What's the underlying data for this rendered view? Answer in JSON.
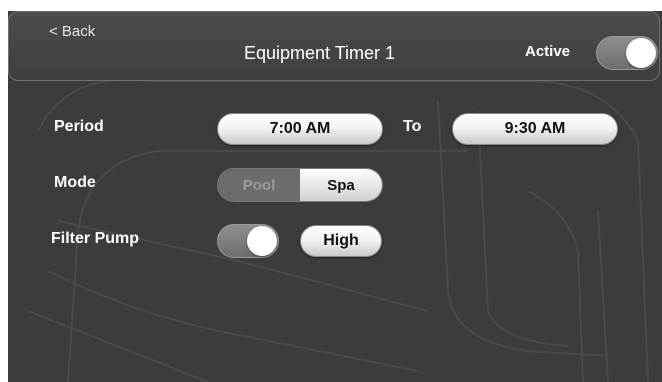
{
  "header": {
    "back_label": "< Back",
    "title": "Equipment Timer 1",
    "active_label": "Active",
    "active_on": true
  },
  "period": {
    "label": "Period",
    "start": "7:00 AM",
    "to_label": "To",
    "end": "9:30 AM"
  },
  "mode": {
    "label": "Mode",
    "options": [
      "Pool",
      "Spa"
    ],
    "selected": "Spa"
  },
  "filter_pump": {
    "label": "Filter Pump",
    "enabled": true,
    "speed": "High"
  }
}
